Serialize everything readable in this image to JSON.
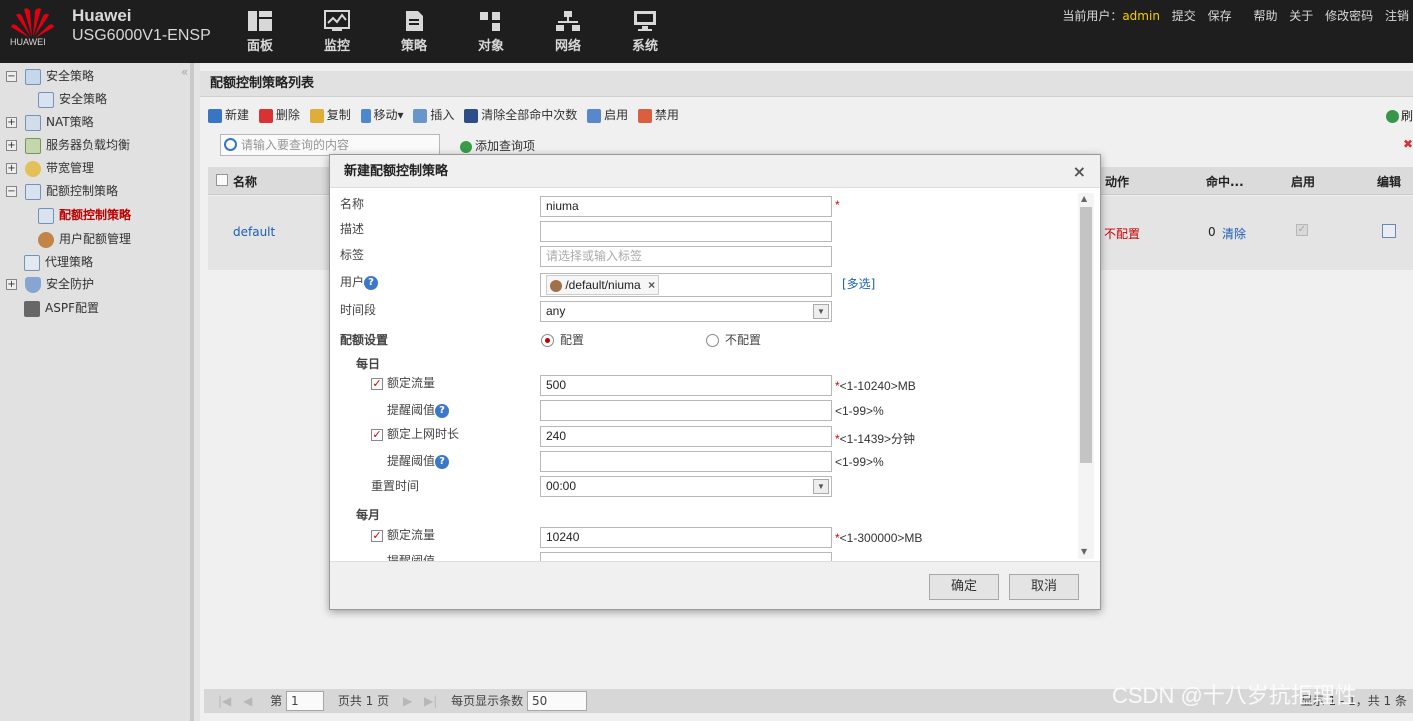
{
  "brand": {
    "logo_text": "HUAWEI",
    "name": "Huawei",
    "model": "USG6000V1-ENSP"
  },
  "nav": [
    {
      "label": "面板",
      "icon": "dashboard-icon"
    },
    {
      "label": "监控",
      "icon": "monitor-icon"
    },
    {
      "label": "策略",
      "icon": "policy-icon"
    },
    {
      "label": "对象",
      "icon": "object-icon"
    },
    {
      "label": "网络",
      "icon": "network-icon"
    },
    {
      "label": "系统",
      "icon": "system-icon"
    }
  ],
  "userbar": {
    "current_user_label": "当前用户：",
    "user": "admin",
    "submit": "提交",
    "save": "保存",
    "help": "帮助",
    "about": "关于",
    "change_pwd": "修改密码",
    "logout": "注销"
  },
  "sidebar": {
    "items": [
      {
        "label": "安全策略",
        "expander": "−"
      },
      {
        "label": "安全策略"
      },
      {
        "label": "NAT策略",
        "expander": "+"
      },
      {
        "label": "服务器负载均衡",
        "expander": "+"
      },
      {
        "label": "带宽管理",
        "expander": "+"
      },
      {
        "label": "配额控制策略",
        "expander": "−"
      },
      {
        "label": "配额控制策略"
      },
      {
        "label": "用户配额管理"
      },
      {
        "label": "代理策略"
      },
      {
        "label": "安全防护",
        "expander": "+"
      },
      {
        "label": "ASPF配置"
      }
    ],
    "collapse": "«"
  },
  "main": {
    "title": "配额控制策略列表",
    "toolbar": {
      "new": "新建",
      "delete": "删除",
      "copy": "复制",
      "move": "移动▾",
      "insert": "插入",
      "clear_hits": "清除全部命中次数",
      "enable": "启用",
      "disable": "禁用",
      "refresh": "刷"
    },
    "search_placeholder": "请输入要查询的内容",
    "add_query": "添加查询项",
    "columns": {
      "name": "名称",
      "action": "动作",
      "hits": "命中...",
      "enabled": "启用",
      "edit": "编辑"
    },
    "row": {
      "name": "default",
      "action": "不配置",
      "hits": "0",
      "clear": "清除"
    },
    "pager": {
      "page_label": "第",
      "page": "1",
      "total": "页共 1 页",
      "per_page_label": "每页显示条数",
      "per_page": "50",
      "summary": "显示 1 - 1，共 1 条"
    }
  },
  "dialog": {
    "title": "新建配额控制策略",
    "close": "×",
    "name_label": "名称",
    "name_value": "niuma",
    "required": "*",
    "desc_label": "描述",
    "desc_value": "",
    "tag_label": "标签",
    "tag_placeholder": "请选择或输入标签",
    "user_label": "用户",
    "user_value": "/default/niuma",
    "user_remove": "×",
    "multi_select": "[多选]",
    "time_label": "时间段",
    "time_value": "any",
    "quota_label": "配额设置",
    "opt_config": "配置",
    "opt_noconfig": "不配置",
    "daily": {
      "title": "每日",
      "traffic_label": "额定流量",
      "traffic_value": "500",
      "traffic_hint": "<1-10240>MB",
      "traffic_alert_label": "提醒阈值",
      "traffic_alert_value": "",
      "alert_hint": "<1-99>%",
      "duration_label": "额定上网时长",
      "duration_value": "240",
      "duration_hint": "<1-1439>分钟",
      "duration_alert_label": "提醒阈值",
      "duration_alert_value": "",
      "reset_label": "重置时间",
      "reset_value": "00:00"
    },
    "monthly": {
      "title": "每月",
      "traffic_label": "额定流量",
      "traffic_value": "10240",
      "traffic_hint": "<1-300000>MB",
      "alert_label": "提醒阈值"
    },
    "ok": "确定",
    "cancel": "取消"
  },
  "watermark": "CSDN @十八岁抗拒理性"
}
